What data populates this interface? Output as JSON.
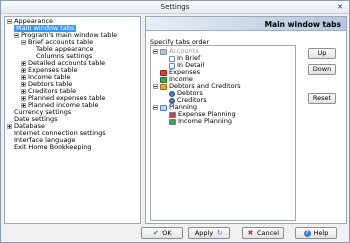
{
  "window": {
    "title": "Settings",
    "close_glyph": "✕"
  },
  "tree": {
    "items": [
      {
        "label": "Appearance",
        "level": 0,
        "expander": "minus"
      },
      {
        "label": "Main window tabs",
        "level": 1,
        "selected": true
      },
      {
        "label": "Program's main window table",
        "level": 1,
        "expander": "minus"
      },
      {
        "label": "Brief accounts table",
        "level": 2,
        "expander": "minus"
      },
      {
        "label": "Table appearance",
        "level": 3
      },
      {
        "label": "Columns settings",
        "level": 3
      },
      {
        "label": "Detailed accounts table",
        "level": 2,
        "expander": "plus"
      },
      {
        "label": "Expenses table",
        "level": 2,
        "expander": "plus"
      },
      {
        "label": "Income table",
        "level": 2,
        "expander": "plus"
      },
      {
        "label": "Debtors table",
        "level": 2,
        "expander": "plus"
      },
      {
        "label": "Creditors table",
        "level": 2,
        "expander": "plus"
      },
      {
        "label": "Planned expenses table",
        "level": 2,
        "expander": "plus"
      },
      {
        "label": "Planned income table",
        "level": 2,
        "expander": "plus"
      },
      {
        "label": "Currency settings",
        "level": 1
      },
      {
        "label": "Date settings",
        "level": 1
      },
      {
        "label": "Database",
        "level": 0,
        "expander": "plus"
      },
      {
        "label": "Internet connection settings",
        "level": 0
      },
      {
        "label": "Interface language",
        "level": 0
      },
      {
        "label": "Exit Home Bookkeeping",
        "level": 0
      }
    ]
  },
  "panel": {
    "title": "Main window tabs",
    "section_label": "Specify tabs order"
  },
  "tabs_list": {
    "items": [
      {
        "label": "Accounts",
        "level": 0,
        "icon": "accounts-icon",
        "disabled": true,
        "expander": true
      },
      {
        "label": "In Brief",
        "level": 1,
        "icon": "document-icon"
      },
      {
        "label": "In Detail",
        "level": 1,
        "icon": "document-icon"
      },
      {
        "label": "Expenses",
        "level": 0,
        "icon": "expenses-icon"
      },
      {
        "label": "Income",
        "level": 0,
        "icon": "income-icon"
      },
      {
        "label": "Debtors and Creditors",
        "level": 0,
        "icon": "debtors-creditors-icon",
        "expander": true
      },
      {
        "label": "Debtors",
        "level": 1,
        "icon": "user-icon"
      },
      {
        "label": "Creditors",
        "level": 1,
        "icon": "user-icon"
      },
      {
        "label": "Planning",
        "level": 0,
        "icon": "planning-icon",
        "expander": true
      },
      {
        "label": "Expense Planning",
        "level": 1,
        "icon": "planning-expense-icon"
      },
      {
        "label": "Income Planning",
        "level": 1,
        "icon": "planning-income-icon"
      }
    ]
  },
  "side_buttons": {
    "up": "Up",
    "down": "Down",
    "reset": "Reset"
  },
  "footer": {
    "ok": "OK",
    "apply": "Apply",
    "cancel": "Cancel",
    "help": "Help",
    "ok_glyph": "✔",
    "apply_glyph": "↻",
    "cancel_glyph": "✖",
    "help_glyph": "?"
  }
}
